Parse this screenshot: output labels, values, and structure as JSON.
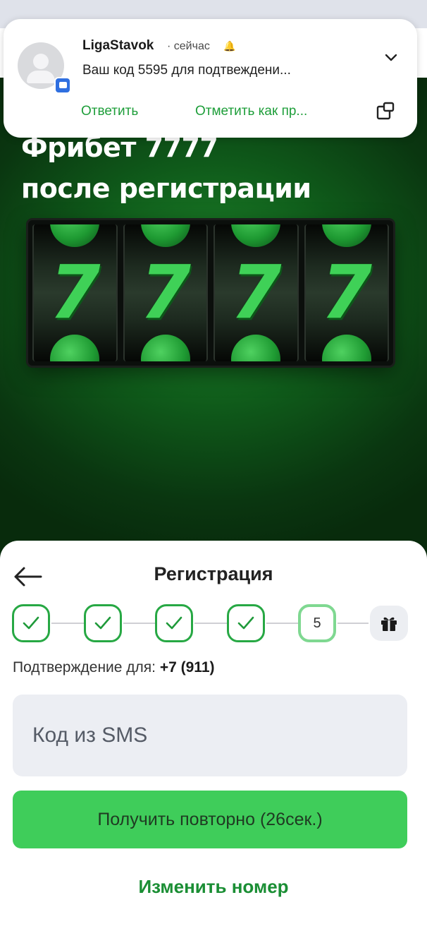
{
  "notification": {
    "app_name": "LigaStavok",
    "time": "сейчас",
    "message": "Ваш код 5595 для подтвеждени...",
    "actions": [
      "Ответить",
      "Отметить как пр..."
    ]
  },
  "promo": {
    "title_line1": "Фрибет 7777",
    "title_line2": "после регистрации",
    "reels": [
      "7",
      "7",
      "7",
      "7"
    ]
  },
  "sheet": {
    "title": "Регистрация",
    "steps": [
      {
        "state": "done"
      },
      {
        "state": "done"
      },
      {
        "state": "done"
      },
      {
        "state": "done"
      },
      {
        "state": "current",
        "label": "5"
      }
    ],
    "confirm_label": "Подтверждение для:",
    "confirm_phone": "+7 (911)",
    "sms_placeholder": "Код из SMS",
    "resend_label": "Получить повторно (26сек.)",
    "change_number_label": "Изменить номер"
  },
  "colors": {
    "accent_green": "#3fcd5a",
    "link_green": "#1a8e34",
    "step_border": "#27a844"
  }
}
